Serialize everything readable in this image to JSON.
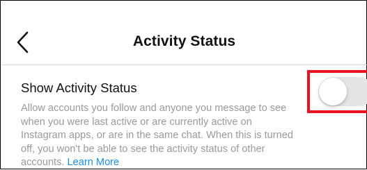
{
  "header": {
    "title": "Activity Status",
    "back_icon": "chevron-left-icon"
  },
  "setting": {
    "title": "Show Activity Status",
    "description": "Allow accounts you follow and anyone you message to see when you were last active or are currently active on Instagram apps, or are in the same chat. When this is turned off, you won't be able to see the activity status of other accounts.",
    "learn_more": "Learn More",
    "toggle_state": "off"
  },
  "colors": {
    "link": "#1a8cf0",
    "highlight": "#e8121f",
    "toggle_off": "#e4e4e4",
    "muted_text": "#9a9a9a"
  }
}
